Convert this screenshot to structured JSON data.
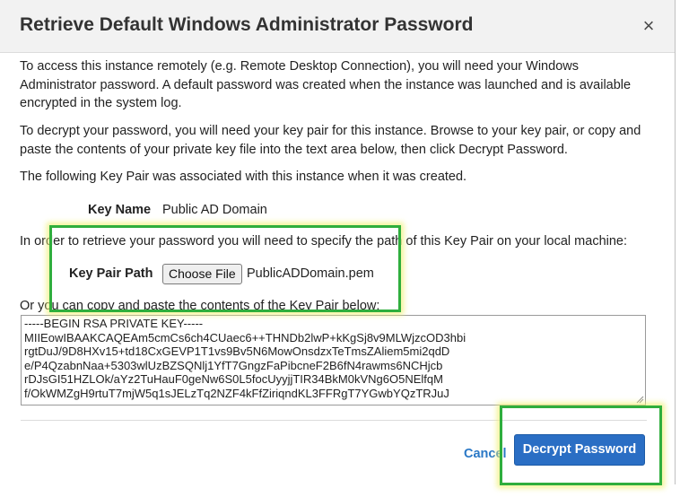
{
  "dialog": {
    "title": "Retrieve Default Windows Administrator Password",
    "close_label": "×",
    "para1": "To access this instance remotely (e.g. Remote Desktop Connection), you will need your Windows Administrator password. A default password was created when the instance was launched and is available encrypted in the system log.",
    "para2": "To decrypt your password, you will need your key pair for this instance. Browse to your key pair, or copy and paste the contents of your private key file into the text area below, then click Decrypt Password.",
    "para3": "The following Key Pair was associated with this instance when it was created.",
    "key_name_label": "Key Name",
    "key_name_value": "Public AD Domain",
    "para4": "In order to retrieve your password you will need to specify the path of this Key Pair on your local machine:",
    "key_pair_path_label": "Key Pair Path",
    "choose_file_label": "Choose File",
    "selected_file": "PublicADDomain.pem",
    "para5": "Or you can copy and paste the contents of the Key Pair below:",
    "key_lines": [
      "-----BEGIN RSA PRIVATE KEY-----",
      "MIIEowIBAAKCAQEAm5cmCs6ch4CUaec6++THNDb2lwP+kKgSj8v9MLWjzcOD3hbi",
      "rgtDuJ/9D8HXv15+td18CxGEVP1T1vs9Bv5N6MowOnsdzxTeTmsZAliem5mi2qdD",
      "e/P4QzabnNaa+5303wlUzBZSQNlj1YfT7GngzFaPibcneF2B6fN4rawms6NCHjcb",
      "rDJsGI51HZLOk/aYz2TuHauF0geNw6S0L5focUyyjjTIR34BkM0kVNg6O5NElfqM",
      "f/OkWMZgH9rtuT7mjW5q1sJELzTq2NZF4kFfZiriqndKL3FFRgT7YGwbYQzTRJuJ"
    ],
    "cancel_label": "Cancel",
    "decrypt_label": "Decrypt Password"
  },
  "colors": {
    "header_bg": "#f2f2f2",
    "primary_button": "#2a6ec4",
    "link": "#2a78c6",
    "annotation_green": "#2fae3d"
  }
}
